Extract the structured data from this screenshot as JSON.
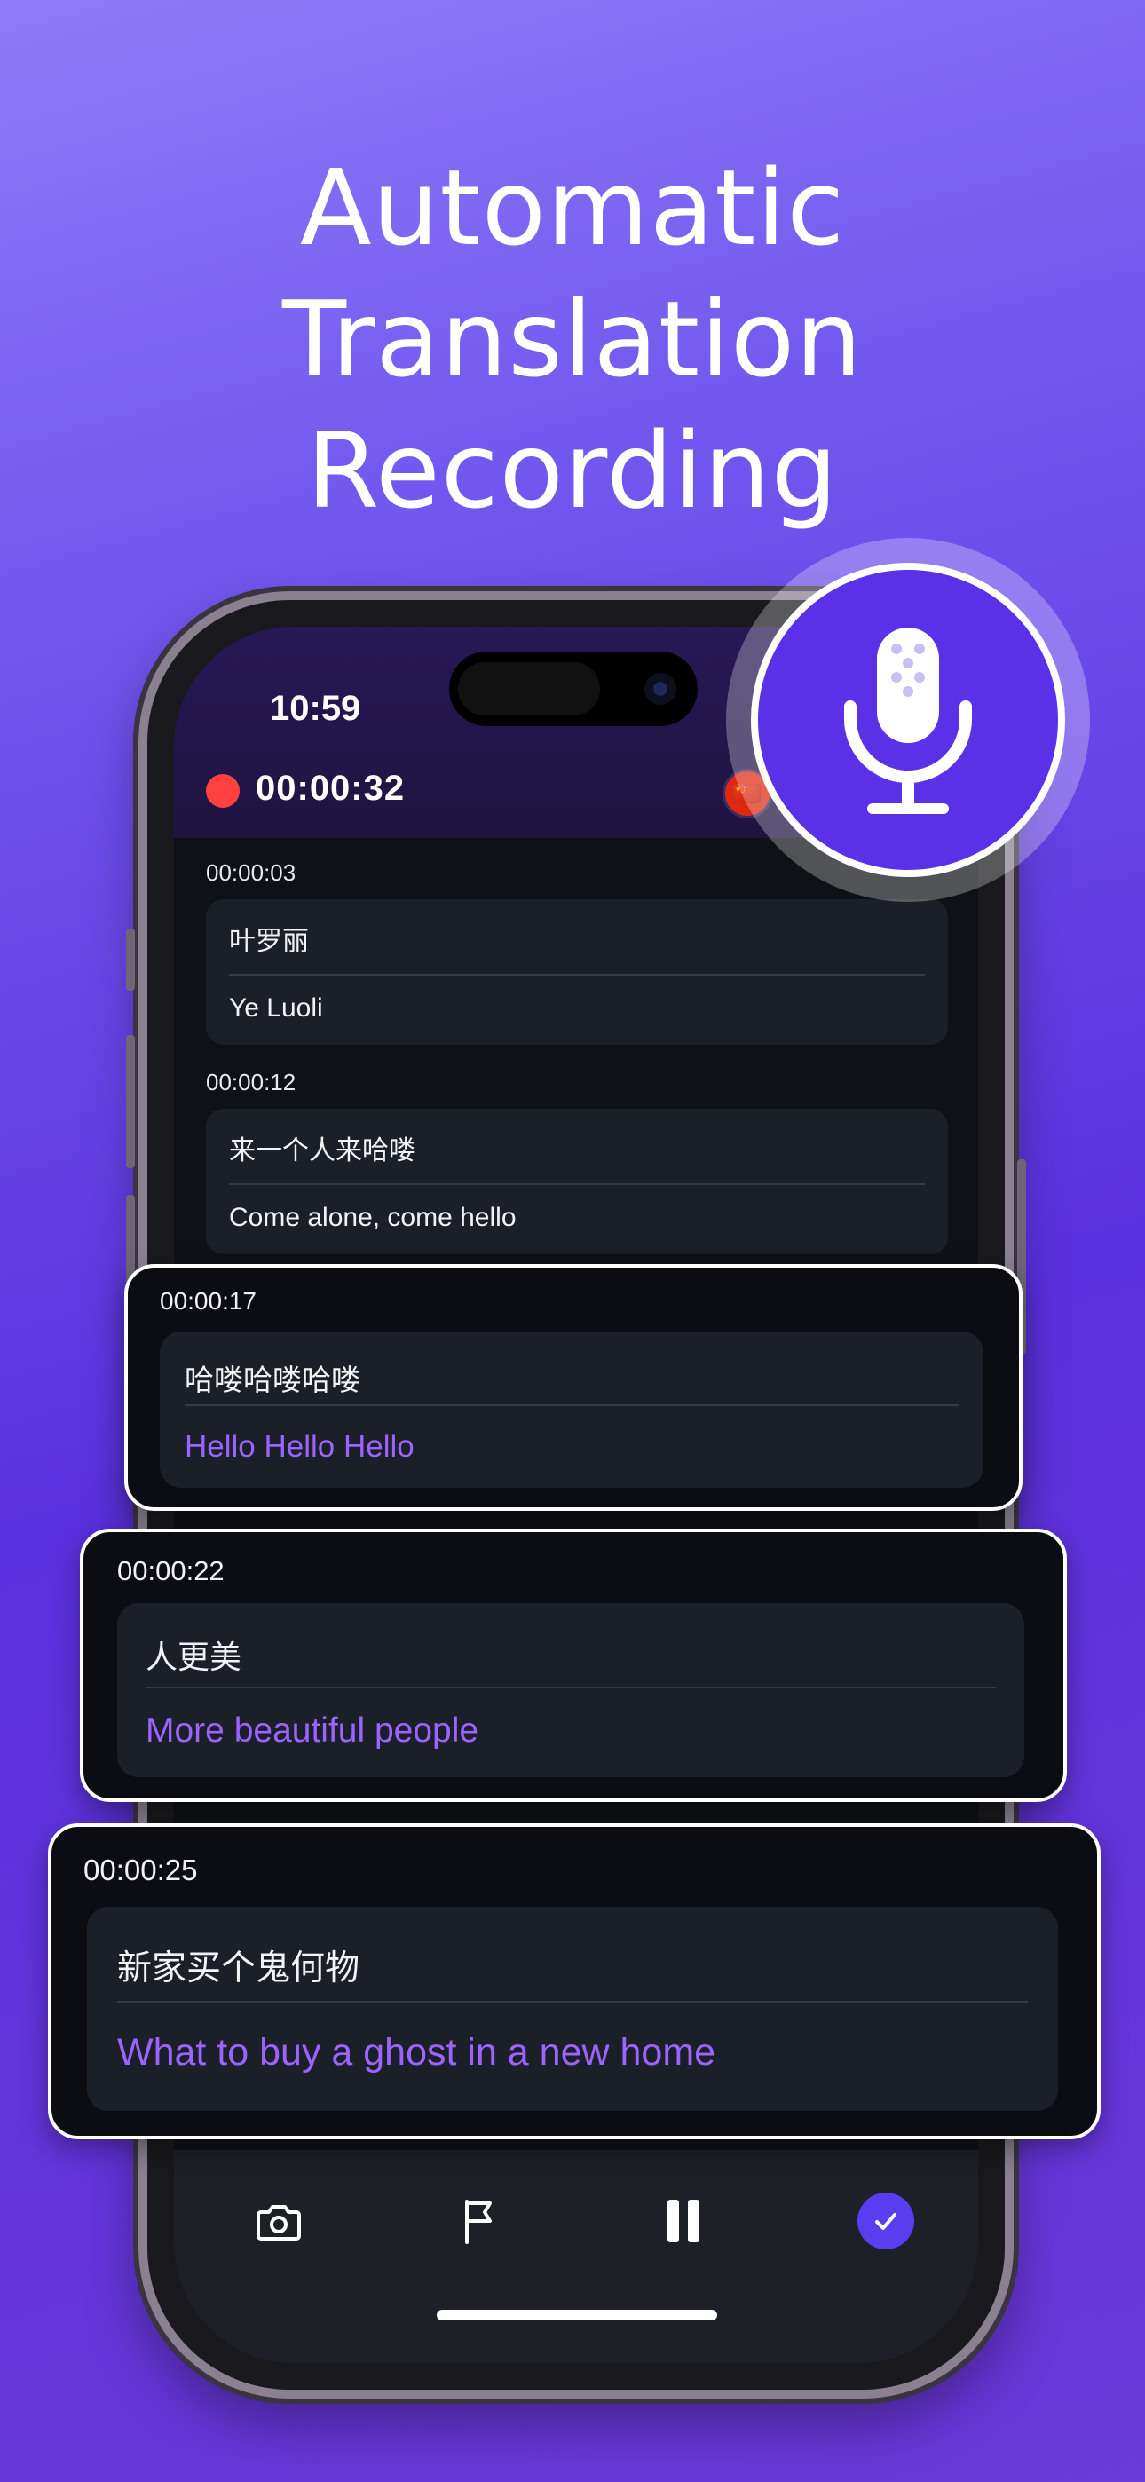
{
  "headline": {
    "line1": "Automatic Translation",
    "line2": "Recording"
  },
  "status_bar": {
    "time": "10:59"
  },
  "recording": {
    "elapsed": "00:00:32",
    "language_flag": "🇨🇳"
  },
  "entries": [
    {
      "timestamp": "00:00:03",
      "original": "叶罗丽",
      "translation": "Ye Luoli"
    },
    {
      "timestamp": "00:00:12",
      "original": "来一个人来哈喽",
      "translation": "Come alone, come hello"
    }
  ],
  "highlighted_entries": [
    {
      "timestamp": "00:00:17",
      "original": "哈喽哈喽哈喽",
      "translation": "Hello Hello Hello"
    },
    {
      "timestamp": "00:00:22",
      "original": "人更美",
      "translation": "More beautiful people"
    },
    {
      "timestamp": "00:00:25",
      "original": "新家买个鬼何物",
      "translation": "What to buy a ghost in a new home"
    }
  ],
  "toolbar": {
    "camera_icon": "camera-icon",
    "flag_icon": "flag-icon",
    "pause_icon": "pause-icon",
    "done_icon": "check-icon"
  },
  "colors": {
    "accent": "#5a31e6",
    "translation_text": "#9b63ff",
    "record_dot": "#ff4140"
  }
}
